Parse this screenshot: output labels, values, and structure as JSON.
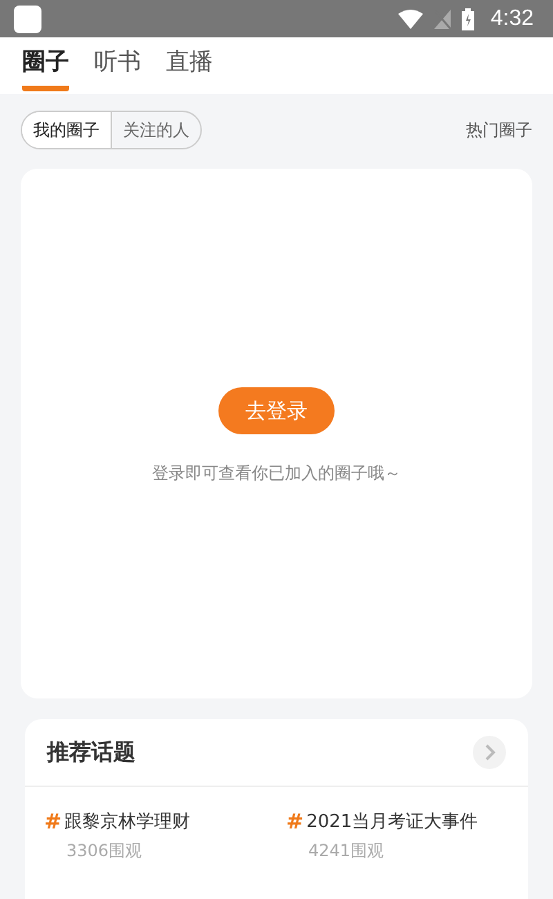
{
  "status_bar": {
    "time": "4:32"
  },
  "tabs": [
    {
      "label": "圈子",
      "selected": true
    },
    {
      "label": "听书",
      "selected": false
    },
    {
      "label": "直播",
      "selected": false
    }
  ],
  "segments": [
    {
      "label": "我的圈子",
      "selected": true
    },
    {
      "label": "关注的人",
      "selected": false
    }
  ],
  "hot_link": "热门圈子",
  "login_card": {
    "button": "去登录",
    "hint": "登录即可查看你已加入的圈子哦～"
  },
  "topics": {
    "title": "推荐话题",
    "items": [
      {
        "mark": "#",
        "name": "跟黎京林学理财",
        "views": "3306围观"
      },
      {
        "mark": "#",
        "name": "2021当月考证大事件",
        "views": "4241围观"
      }
    ]
  }
}
